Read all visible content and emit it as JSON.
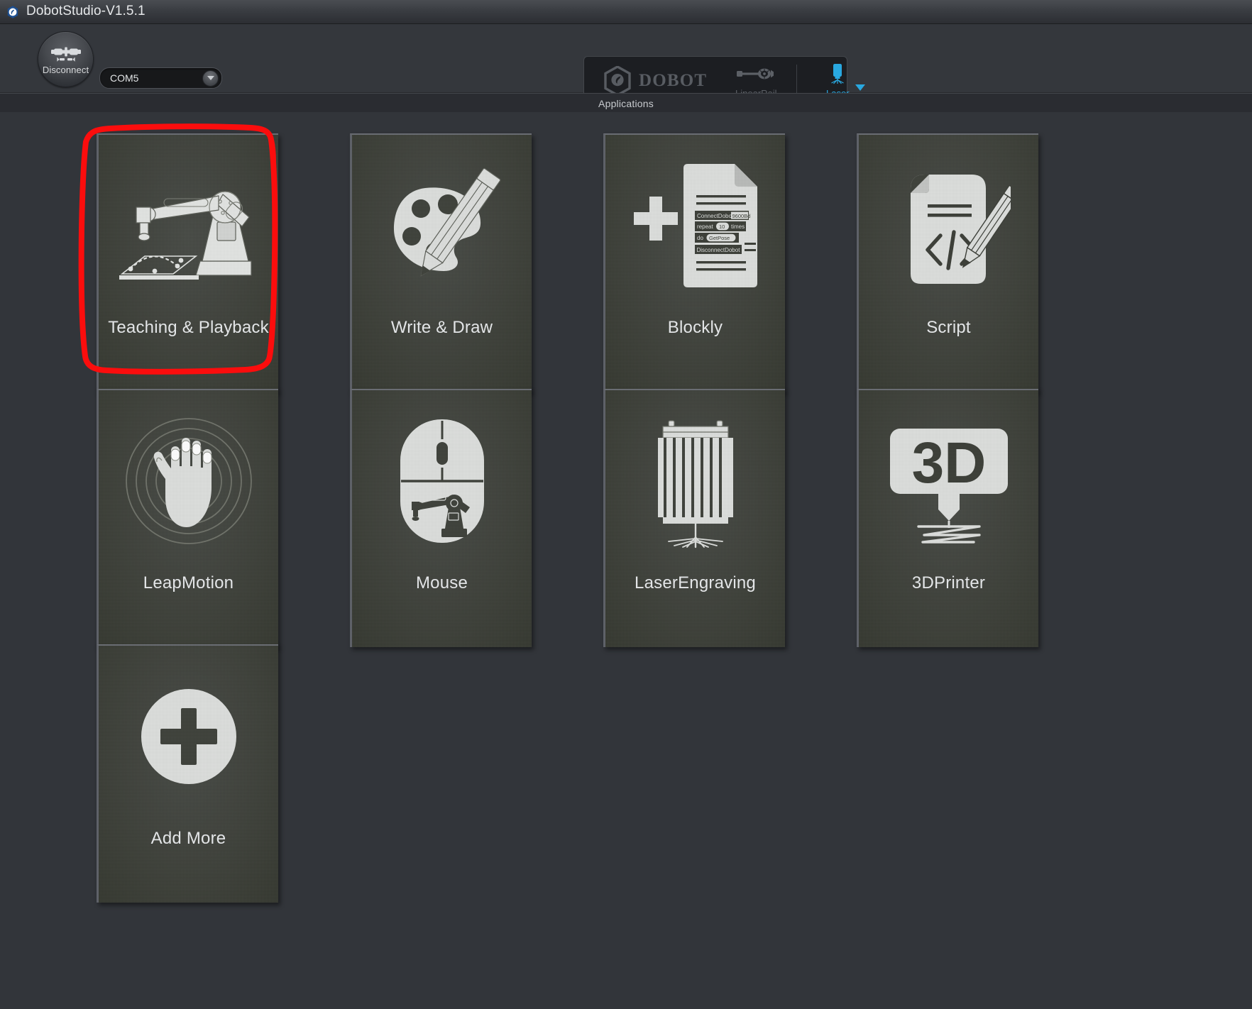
{
  "window": {
    "title": "DobotStudio-V1.5.1",
    "logo_icon": "dobot-app-logo-icon"
  },
  "toolbar": {
    "connect_button": {
      "label": "Disconnect",
      "icon": "plug-connector-icon"
    },
    "port_select": {
      "value": "COM5",
      "arrow_icon": "chevron-down-icon"
    },
    "device_panel": {
      "brand": "DOBOT",
      "brand_icon": "dobot-hex-logo-icon",
      "items": [
        {
          "label": "LinearRail",
          "icon": "linear-rail-icon",
          "active": false
        },
        {
          "label": "Laser",
          "icon": "laser-module-icon",
          "active": true
        }
      ],
      "dropdown_icon": "caret-down-icon",
      "active_color": "#29a8e0",
      "inactive_color": "#5c6066"
    }
  },
  "section": {
    "header": "Applications"
  },
  "applications": [
    {
      "label": "Teaching & Playback",
      "icon": "robot-arm-teaching-icon",
      "highlighted": true
    },
    {
      "label": "Write & Draw",
      "icon": "palette-pencil-icon",
      "highlighted": false
    },
    {
      "label": "Blockly",
      "icon": "blockly-document-icon",
      "highlighted": false
    },
    {
      "label": "Script",
      "icon": "script-code-document-icon",
      "highlighted": false
    },
    {
      "label": "LeapMotion",
      "icon": "hand-waves-icon",
      "highlighted": false
    },
    {
      "label": "Mouse",
      "icon": "mouse-robot-icon",
      "highlighted": false
    },
    {
      "label": "LaserEngraving",
      "icon": "laser-engraving-icon",
      "highlighted": false
    },
    {
      "label": "3DPrinter",
      "icon": "3d-printer-icon",
      "highlighted": false
    },
    {
      "label": "Add More",
      "icon": "plus-circle-icon",
      "highlighted": false
    }
  ],
  "blockly_icon_text": {
    "line1": "ConnectDobot",
    "line1_field": "9600Bd",
    "line2a": "repeat",
    "line2b": "10",
    "line2c": "times",
    "line3a": "do",
    "line3b": "GetPose",
    "line4": "DisconnectDobot"
  },
  "printer_icon_text": "3D",
  "annotation": {
    "shape": "hand-drawn-rectangle",
    "color": "#fb0d0d",
    "target": "Teaching & Playback"
  },
  "colors": {
    "window_background": "#2f3136",
    "grid_background": "#32353a",
    "tile_background": "#3e4139",
    "accent": "#29a8e0",
    "annotation_red": "#fb0d0d"
  }
}
